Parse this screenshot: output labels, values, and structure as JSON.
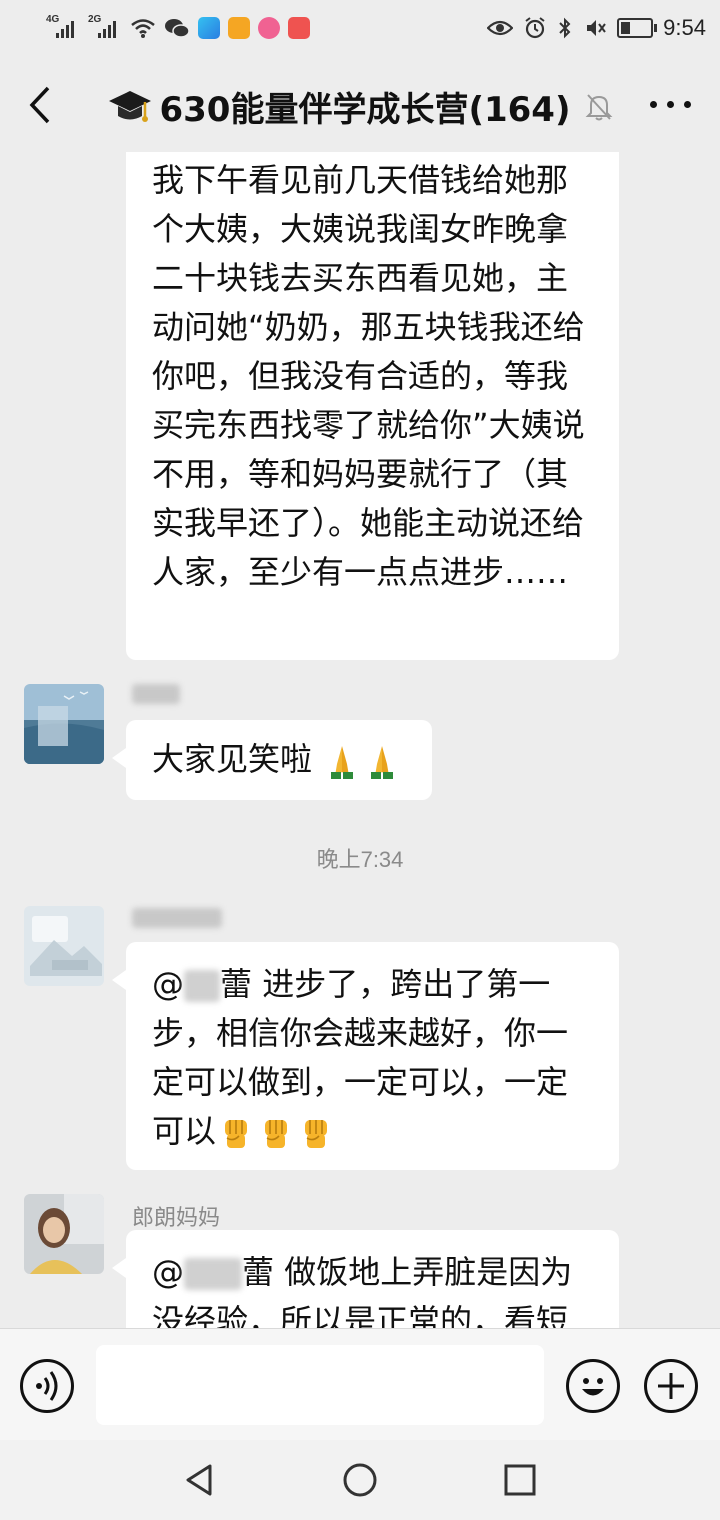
{
  "status_bar": {
    "network_1": "4G",
    "network_2": "2G",
    "time": "9:54",
    "battery_level": 0.35
  },
  "header": {
    "title": "630能量伴学成长营(164)",
    "title_icon": "graduation-cap-icon",
    "back_icon": "chevron-left-icon",
    "mute_icon": "bell-off-icon",
    "more_icon": "more-dots-icon"
  },
  "messages": {
    "msg1": {
      "text": "我下午看见前几天借钱给她那个大姨，大姨说我闺女昨晚拿二十块钱去买东西看见她，主动问她“奶奶，那五块钱我还给你吧，但我没有合适的，等我买完东西找零了就给你”大姨说不用，等和妈妈要就行了（其实我早还了）。她能主动说还给人家，至少有一点点进步……"
    },
    "msg2": {
      "text": "大家见笑啦",
      "emoji": "folded-hands-emoji"
    },
    "timestamp": "晚上7:34",
    "msg3": {
      "mention_prefix": "@",
      "mention_tail": "蕾",
      "text": "进步了，跨出了第一步，相信你会越来越好，你一定可以做到，一定可以，一定可以",
      "emoji": "raised-fist-emoji"
    },
    "msg4": {
      "sender": "郎朗妈妈",
      "mention_prefix": "@",
      "mention_tail": "蕾",
      "text": "做饭地上弄脏是因为没经验，所以是正常的，看短视"
    }
  },
  "input_bar": {
    "placeholder": "",
    "voice_icon": "voice-icon",
    "emoji_icon": "smiley-icon",
    "plus_icon": "plus-icon"
  },
  "nav_bar": {
    "back_icon": "triangle-back-icon",
    "home_icon": "circle-home-icon",
    "recents_icon": "square-recents-icon"
  },
  "colors": {
    "background": "#ededed",
    "bubble": "#ffffff",
    "text": "#111111",
    "meta_text": "#8a8a8a"
  }
}
